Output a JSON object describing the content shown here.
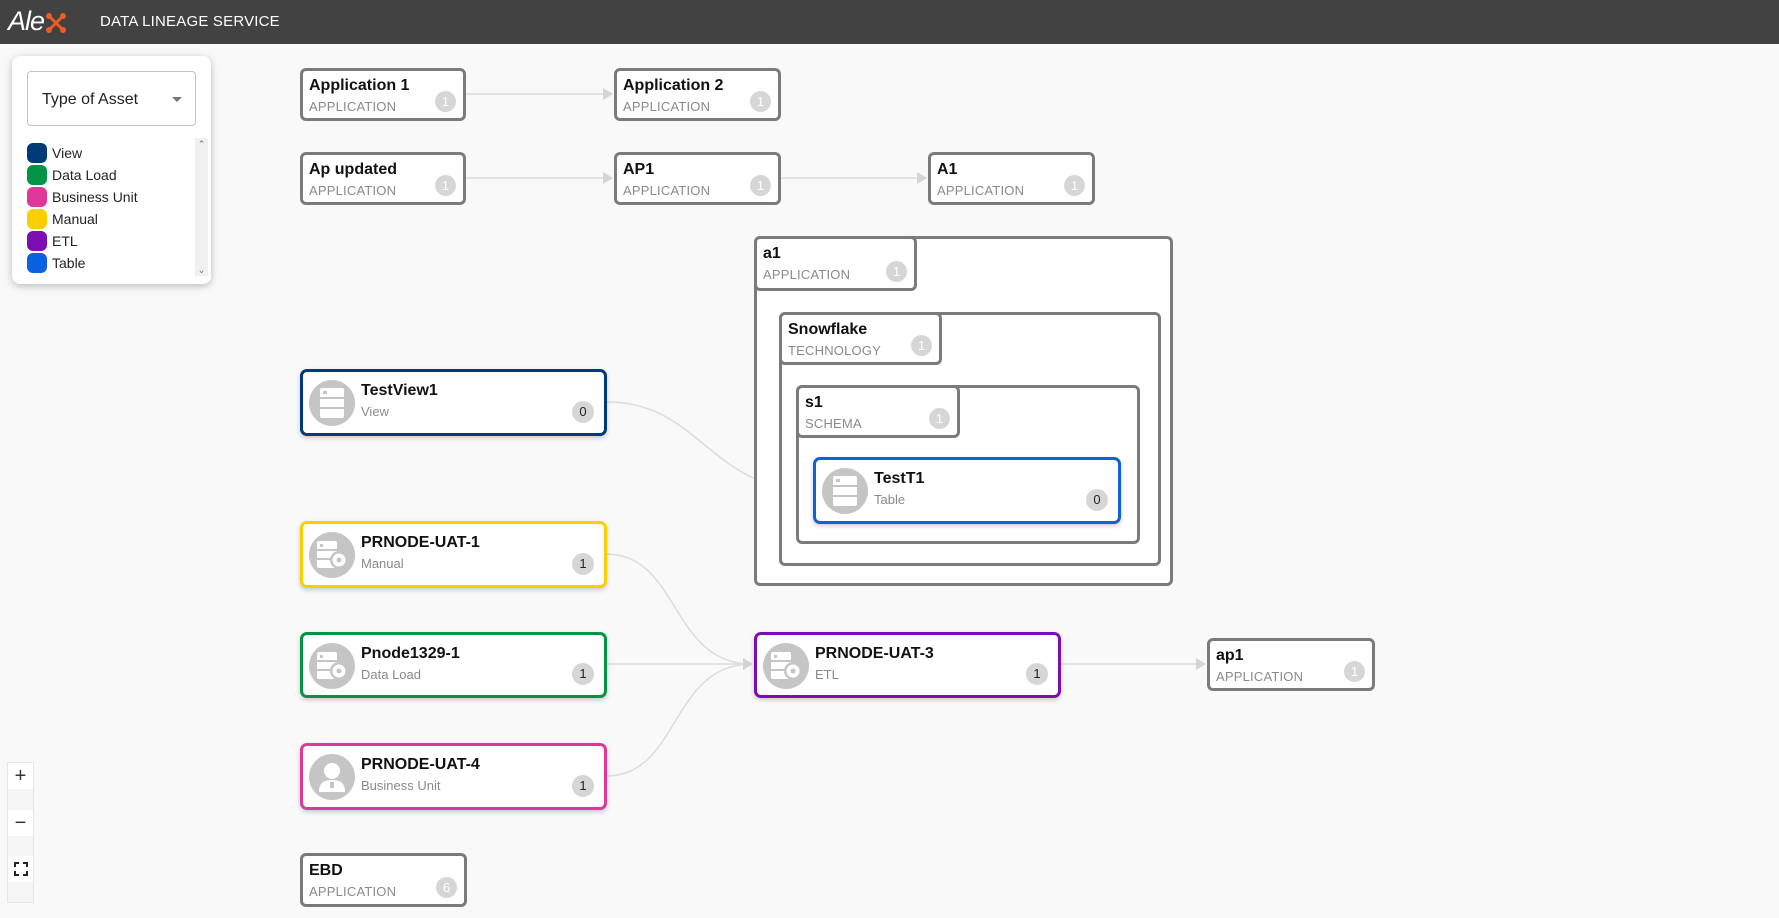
{
  "header": {
    "logo_text": "Ale",
    "logo_accent_color": "#f15a24",
    "title": "DATA LINEAGE SERVICE"
  },
  "legend": {
    "select_label": "Type of Asset",
    "items": [
      {
        "label": "View",
        "color": "#003a78"
      },
      {
        "label": "Data Load",
        "color": "#009444"
      },
      {
        "label": "Business Unit",
        "color": "#e0379a"
      },
      {
        "label": "Manual",
        "color": "#f8d000"
      },
      {
        "label": "ETL",
        "color": "#7c0db2"
      },
      {
        "label": "Table",
        "color": "#0a62e0"
      }
    ],
    "scroll_up": "^",
    "scroll_down": "v"
  },
  "applications": {
    "application1": {
      "name": "Application 1",
      "type": "APPLICATION",
      "count": "1"
    },
    "application2": {
      "name": "Application 2",
      "type": "APPLICATION",
      "count": "1"
    },
    "ap_updated": {
      "name": "Ap updated",
      "type": "APPLICATION",
      "count": "1"
    },
    "AP1": {
      "name": "AP1",
      "type": "APPLICATION",
      "count": "1"
    },
    "A1": {
      "name": "A1",
      "type": "APPLICATION",
      "count": "1"
    },
    "ap1": {
      "name": "ap1",
      "type": "APPLICATION",
      "count": "1"
    },
    "EBD": {
      "name": "EBD",
      "type": "APPLICATION",
      "count": "6"
    }
  },
  "groups": {
    "a1": {
      "name": "a1",
      "type": "APPLICATION",
      "count": "1"
    },
    "snowflake": {
      "name": "Snowflake",
      "type": "TECHNOLOGY",
      "count": "1"
    },
    "s1": {
      "name": "s1",
      "type": "SCHEMA",
      "count": "1"
    }
  },
  "assets": {
    "testview1": {
      "name": "TestView1",
      "type": "View",
      "count": "0",
      "color": "#003a78",
      "icon": "table-icon"
    },
    "testt1": {
      "name": "TestT1",
      "type": "Table",
      "count": "0",
      "color": "#0a62e0",
      "icon": "table-icon"
    },
    "prnode_uat_1": {
      "name": "PRNODE-UAT-1",
      "type": "Manual",
      "count": "1",
      "color": "#f8d000",
      "icon": "process-gear-icon"
    },
    "pnode1329_1": {
      "name": "Pnode1329-1",
      "type": "Data Load",
      "count": "1",
      "color": "#009444",
      "icon": "process-gear-icon"
    },
    "prnode_uat_4": {
      "name": "PRNODE-UAT-4",
      "type": "Business Unit",
      "count": "1",
      "color": "#e0379a",
      "icon": "user-icon"
    },
    "prnode_uat_3": {
      "name": "PRNODE-UAT-3",
      "type": "ETL",
      "count": "1",
      "color": "#7c0db2",
      "icon": "process-gear-icon"
    }
  },
  "zoom_controls": {
    "zoom_in": "+",
    "zoom_out": "−"
  }
}
